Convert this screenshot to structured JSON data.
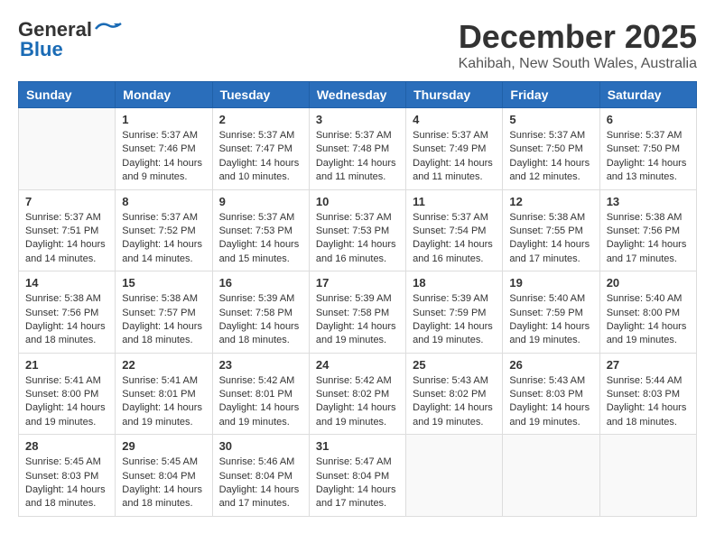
{
  "logo": {
    "general": "General",
    "blue": "Blue"
  },
  "title": "December 2025",
  "subtitle": "Kahibah, New South Wales, Australia",
  "days_header": [
    "Sunday",
    "Monday",
    "Tuesday",
    "Wednesday",
    "Thursday",
    "Friday",
    "Saturday"
  ],
  "weeks": [
    [
      {
        "day": "",
        "info": ""
      },
      {
        "day": "1",
        "info": "Sunrise: 5:37 AM\nSunset: 7:46 PM\nDaylight: 14 hours\nand 9 minutes."
      },
      {
        "day": "2",
        "info": "Sunrise: 5:37 AM\nSunset: 7:47 PM\nDaylight: 14 hours\nand 10 minutes."
      },
      {
        "day": "3",
        "info": "Sunrise: 5:37 AM\nSunset: 7:48 PM\nDaylight: 14 hours\nand 11 minutes."
      },
      {
        "day": "4",
        "info": "Sunrise: 5:37 AM\nSunset: 7:49 PM\nDaylight: 14 hours\nand 11 minutes."
      },
      {
        "day": "5",
        "info": "Sunrise: 5:37 AM\nSunset: 7:50 PM\nDaylight: 14 hours\nand 12 minutes."
      },
      {
        "day": "6",
        "info": "Sunrise: 5:37 AM\nSunset: 7:50 PM\nDaylight: 14 hours\nand 13 minutes."
      }
    ],
    [
      {
        "day": "7",
        "info": "Sunrise: 5:37 AM\nSunset: 7:51 PM\nDaylight: 14 hours\nand 14 minutes."
      },
      {
        "day": "8",
        "info": "Sunrise: 5:37 AM\nSunset: 7:52 PM\nDaylight: 14 hours\nand 14 minutes."
      },
      {
        "day": "9",
        "info": "Sunrise: 5:37 AM\nSunset: 7:53 PM\nDaylight: 14 hours\nand 15 minutes."
      },
      {
        "day": "10",
        "info": "Sunrise: 5:37 AM\nSunset: 7:53 PM\nDaylight: 14 hours\nand 16 minutes."
      },
      {
        "day": "11",
        "info": "Sunrise: 5:37 AM\nSunset: 7:54 PM\nDaylight: 14 hours\nand 16 minutes."
      },
      {
        "day": "12",
        "info": "Sunrise: 5:38 AM\nSunset: 7:55 PM\nDaylight: 14 hours\nand 17 minutes."
      },
      {
        "day": "13",
        "info": "Sunrise: 5:38 AM\nSunset: 7:56 PM\nDaylight: 14 hours\nand 17 minutes."
      }
    ],
    [
      {
        "day": "14",
        "info": "Sunrise: 5:38 AM\nSunset: 7:56 PM\nDaylight: 14 hours\nand 18 minutes."
      },
      {
        "day": "15",
        "info": "Sunrise: 5:38 AM\nSunset: 7:57 PM\nDaylight: 14 hours\nand 18 minutes."
      },
      {
        "day": "16",
        "info": "Sunrise: 5:39 AM\nSunset: 7:58 PM\nDaylight: 14 hours\nand 18 minutes."
      },
      {
        "day": "17",
        "info": "Sunrise: 5:39 AM\nSunset: 7:58 PM\nDaylight: 14 hours\nand 19 minutes."
      },
      {
        "day": "18",
        "info": "Sunrise: 5:39 AM\nSunset: 7:59 PM\nDaylight: 14 hours\nand 19 minutes."
      },
      {
        "day": "19",
        "info": "Sunrise: 5:40 AM\nSunset: 7:59 PM\nDaylight: 14 hours\nand 19 minutes."
      },
      {
        "day": "20",
        "info": "Sunrise: 5:40 AM\nSunset: 8:00 PM\nDaylight: 14 hours\nand 19 minutes."
      }
    ],
    [
      {
        "day": "21",
        "info": "Sunrise: 5:41 AM\nSunset: 8:00 PM\nDaylight: 14 hours\nand 19 minutes."
      },
      {
        "day": "22",
        "info": "Sunrise: 5:41 AM\nSunset: 8:01 PM\nDaylight: 14 hours\nand 19 minutes."
      },
      {
        "day": "23",
        "info": "Sunrise: 5:42 AM\nSunset: 8:01 PM\nDaylight: 14 hours\nand 19 minutes."
      },
      {
        "day": "24",
        "info": "Sunrise: 5:42 AM\nSunset: 8:02 PM\nDaylight: 14 hours\nand 19 minutes."
      },
      {
        "day": "25",
        "info": "Sunrise: 5:43 AM\nSunset: 8:02 PM\nDaylight: 14 hours\nand 19 minutes."
      },
      {
        "day": "26",
        "info": "Sunrise: 5:43 AM\nSunset: 8:03 PM\nDaylight: 14 hours\nand 19 minutes."
      },
      {
        "day": "27",
        "info": "Sunrise: 5:44 AM\nSunset: 8:03 PM\nDaylight: 14 hours\nand 18 minutes."
      }
    ],
    [
      {
        "day": "28",
        "info": "Sunrise: 5:45 AM\nSunset: 8:03 PM\nDaylight: 14 hours\nand 18 minutes."
      },
      {
        "day": "29",
        "info": "Sunrise: 5:45 AM\nSunset: 8:04 PM\nDaylight: 14 hours\nand 18 minutes."
      },
      {
        "day": "30",
        "info": "Sunrise: 5:46 AM\nSunset: 8:04 PM\nDaylight: 14 hours\nand 17 minutes."
      },
      {
        "day": "31",
        "info": "Sunrise: 5:47 AM\nSunset: 8:04 PM\nDaylight: 14 hours\nand 17 minutes."
      },
      {
        "day": "",
        "info": ""
      },
      {
        "day": "",
        "info": ""
      },
      {
        "day": "",
        "info": ""
      }
    ]
  ]
}
